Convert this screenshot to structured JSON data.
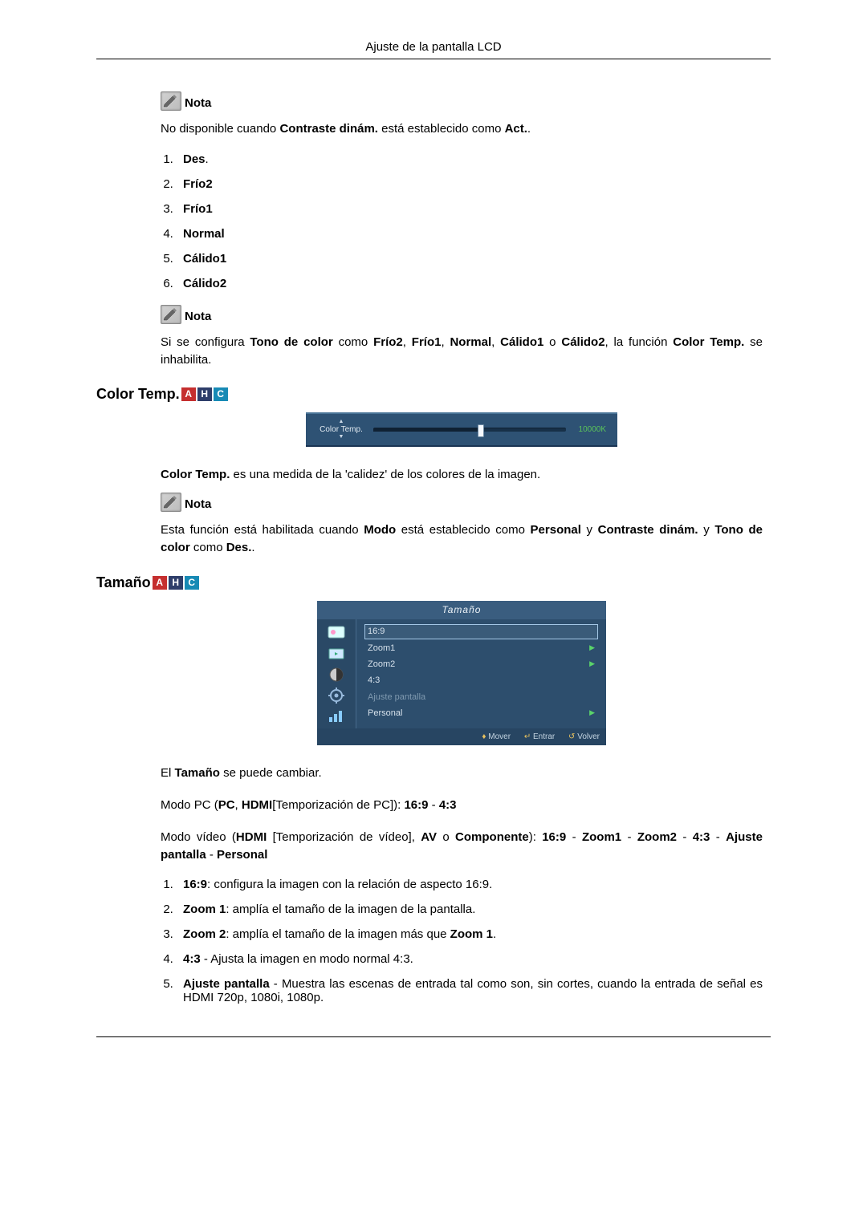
{
  "page_header": "Ajuste de la pantalla LCD",
  "nota_label": "Nota",
  "note1_before": "No disponible cuando ",
  "note1_bold1": "Contraste dinám.",
  "note1_mid": " está establecido como ",
  "note1_bold2": "Act.",
  "note1_after": ".",
  "list1": {
    "i1": "Des",
    "i2": "Frío2",
    "i3": "Frío1",
    "i4": "Normal",
    "i5": "Cálido1",
    "i6": "Cálido2"
  },
  "note2_a": "Si se configura ",
  "note2_b": "Tono de color",
  "note2_c": " como ",
  "note2_d": "Frío2",
  "note2_e": ", ",
  "note2_f": "Frío1",
  "note2_g": ", ",
  "note2_h": "Normal",
  "note2_i": ", ",
  "note2_j": "Cálido1",
  "note2_k": " o ",
  "note2_l": "Cálido2",
  "note2_m": ", la función ",
  "note2_n": "Color Temp.",
  "note2_o": " se inhabilita.",
  "sec_colortemp": "Color Temp.",
  "badge_a": "A",
  "badge_h": "H",
  "badge_c": "C",
  "slider": {
    "label": "Color Temp.",
    "up": "▲",
    "down": "▼",
    "value": "10000K"
  },
  "ct_para_b1": "Color Temp.",
  "ct_para_rest": " es una medida de la 'calidez' de los colores de la imagen.",
  "note3_a": "Esta función está habilitada cuando ",
  "note3_b": "Modo",
  "note3_c": " está establecido como ",
  "note3_d": "Personal",
  "note3_e": " y ",
  "note3_f": "Contraste dinám.",
  "note3_g": " y ",
  "note3_h": "Tono de color",
  "note3_i": " como ",
  "note3_j": "Des.",
  "note3_k": ".",
  "sec_tamano": "Tamaño",
  "osd": {
    "title": "Tamaño",
    "i1": "16:9",
    "i2": "Zoom1",
    "i3": "Zoom2",
    "i4": "4:3",
    "i5": "Ajuste pantalla",
    "i6": "Personal",
    "mover_sym": "♦",
    "mover": "Mover",
    "entrar_sym": "↵",
    "entrar": "Entrar",
    "volver_sym": "↺",
    "volver": "Volver"
  },
  "tam_p1_a": "El ",
  "tam_p1_b": "Tamaño",
  "tam_p1_c": " se puede cambiar.",
  "tam_p2_a": "Modo PC (",
  "tam_p2_b": "PC",
  "tam_p2_c": ", ",
  "tam_p2_d": "HDMI",
  "tam_p2_e": "[Temporización de PC]): ",
  "tam_p2_f": "16:9",
  "tam_p2_g": " - ",
  "tam_p2_h": "4:3",
  "tam_p3_a": "Modo vídeo (",
  "tam_p3_b": "HDMI",
  "tam_p3_c": " [Temporización de vídeo], ",
  "tam_p3_d": "AV",
  "tam_p3_e": " o ",
  "tam_p3_f": "Componente",
  "tam_p3_g": "): ",
  "tam_p3_h": "16:9",
  "tam_p3_i": " - ",
  "tam_p3_j": "Zoom1",
  "tam_p3_k": " - ",
  "tam_p3_l": "Zoom2",
  "tam_p3_m": " - ",
  "tam_p3_n": "4:3",
  "tam_p3_o": " - ",
  "tam_p3_p": "Ajuste pantalla",
  "tam_p3_q": " - ",
  "tam_p3_r": "Personal",
  "list2": {
    "l1_b": "16:9",
    "l1_t": ": configura la imagen con la relación de aspecto 16:9.",
    "l2_b": "Zoom 1",
    "l2_t": ": amplía el tamaño de la imagen de la pantalla.",
    "l3_b": "Zoom 2",
    "l3_t1": ": amplía el tamaño de la imagen más que ",
    "l3_b2": "Zoom 1",
    "l3_t2": ".",
    "l4_b": "4:3",
    "l4_t": " - Ajusta la imagen en modo normal 4:3.",
    "l5_b": "Ajuste pantalla",
    "l5_t": " - Muestra las escenas de entrada tal como son, sin cortes, cuando la entrada de señal es HDMI 720p, 1080i, 1080p."
  }
}
